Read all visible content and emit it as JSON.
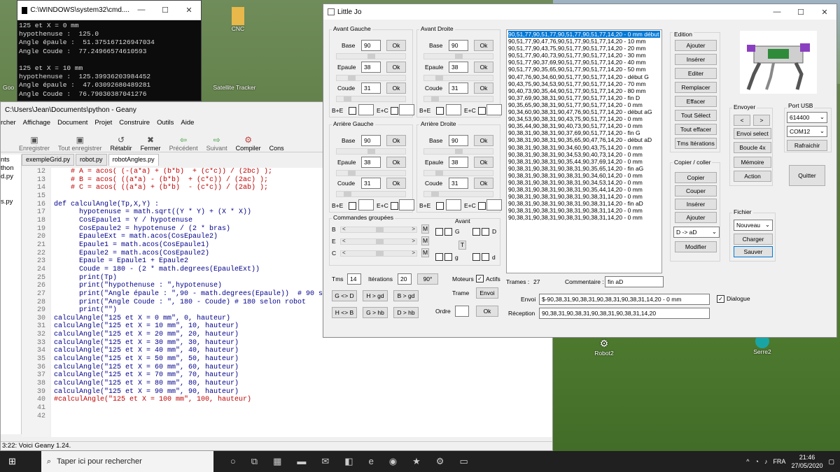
{
  "cmd": {
    "title": "C:\\WINDOWS\\system32\\cmd....",
    "lines": [
      "125 et X = 0 mm",
      "hypothenuse :  125.0",
      "Angle épaule :  51.375167126947034",
      "Angle Coude :  77.24966574610593",
      "",
      "125 et X = 10 mm",
      "hypothenuse :  125.39936203984452",
      "Angle épaule :  47.03092680489281",
      "Angle Coude :  76.79030387041276"
    ]
  },
  "desktop": {
    "cnc": "CNC",
    "satellite": "Satellite Tracker",
    "goo": "Goo",
    "robot2": "Robot2",
    "serre2": "Serre2"
  },
  "geany": {
    "title": "C:\\Users\\Jean\\Documents\\python - Geany",
    "menu": [
      "rcher",
      "Affichage",
      "Document",
      "Projet",
      "Construire",
      "Outils",
      "Aide"
    ],
    "tools": [
      "Enregistrer",
      "Tout enregistrer",
      "Rétablir",
      "Fermer",
      "Précédent",
      "Suivant",
      "Compiler",
      "Cons"
    ],
    "tabs": [
      "exempleGrid.py",
      "robot.py",
      "robotAngles.py"
    ],
    "side": [
      "nts",
      "thon",
      "d.py",
      "",
      "",
      "s.py"
    ],
    "gutter": "12\n13\n14\n15\n16\n17\n18\n19\n20\n21\n22\n23\n24\n25\n26\n27\n28\n29\n30\n31\n32\n33\n34\n35\n36\n37\n38\n39\n40\n41\n42",
    "code_red_top": "    # A = acos( (-(a*a) + (b*b)  + (c*c)) / (2bc) );\n    # B = acos( ((a*a) - (b*b)  + (c*c)) / (2ac) );\n    # C = acos( ((a*a) + (b*b)  - (c*c)) / (2ab) );",
    "code_def": "\n\ndef calculAngle(Tp,X,Y) :\n      hypotenuse = math.sqrt((Y * Y) + (X * X))\n      CosEpaule1 = Y / hypotenuse\n      CosEpaule2 = hypotenuse / (2 * bras)\n      EpauleExt = math.acos(CosEpaule2)\n      Epaule1 = math.acos(CosEpaule1)\n      Epaule2 = math.acos(CosEpaule2)\n      Epaule = Epaule1 + Epaule2\n      Coude = 180 - (2 * math.degrees(EpauleExt))\n      print(Tp)\n      print(\"hypothenuse : \",hypotenuse)\n      print(\"Angle épaule : \",90 - math.degrees(Epaule))  # 90 s\n      print(\"Angle Coude : \", 180 - Coude) # 180 selon robot\n      print(\"\")\n",
    "code_calls": "calculAngle(\"125 et X = 0 mm\", 0, hauteur)\ncalculAngle(\"125 et X = 10 mm\", 10, hauteur)\ncalculAngle(\"125 et X = 20 mm\", 20, hauteur)\ncalculAngle(\"125 et X = 30 mm\", 30, hauteur)\ncalculAngle(\"125 et X = 40 mm\", 40, hauteur)\ncalculAngle(\"125 et X = 50 mm\", 50, hauteur)\ncalculAngle(\"125 et X = 60 mm\", 60, hauteur)\ncalculAngle(\"125 et X = 70 mm\", 70, hauteur)\ncalculAngle(\"125 et X = 80 mm\", 80, hauteur)\ncalculAngle(\"125 et X = 90 mm\", 90, hauteur)",
    "code_last": "#calculAngle(\"125 et X = 100 mm\", 100, hauteur)",
    "status": "3:22: Voici Geany 1.24."
  },
  "lj": {
    "title": "Little Jo",
    "legs": [
      {
        "name": "Avant Gauche",
        "base": "90",
        "epaule": "38",
        "coude": "31"
      },
      {
        "name": "Avant Droite",
        "base": "90",
        "epaule": "38",
        "coude": "31"
      },
      {
        "name": "Arrière Gauche",
        "base": "90",
        "epaule": "38",
        "coude": "31"
      },
      {
        "name": "Arrière Droite",
        "base": "90",
        "epaule": "38",
        "coude": "31"
      }
    ],
    "lbl_base": "Base",
    "lbl_epaule": "Epaule",
    "lbl_coude": "Coude",
    "ok": "Ok",
    "be": "B+E",
    "ec": "E+C",
    "cmdgrp": "Commandes groupées",
    "b": "B",
    "e": "E",
    "c": "C",
    "m": "M",
    "avant": "Avant",
    "g": "G",
    "d": "D",
    "t": "T",
    "gs": "g",
    "ds": "d",
    "tms_lbl": "Tms",
    "tms": "14",
    "iter_lbl": "Itérations",
    "iter": "20",
    "deg90": "90°",
    "moteurs": "Moteurs",
    "actifs": "Actifs",
    "gd": "G <> D",
    "hgd": "H > gd",
    "bgd": "B > gd",
    "hb": "H <> B",
    "ghb": "G > hb",
    "dhb": "D > hb",
    "trame": "Trame",
    "envoi_btn": "Envoi",
    "ordre": "Ordre",
    "ok2": "Ok",
    "list": [
      "90,51,77,90,51,77,90,51,77,90,51,77,14,20 - 0 mm début",
      "90,51,77,90,47,76,90,51,77,90,51,77,14,20 - 10 mm",
      "90,51,77,90,43,75,90,51,77,90,51,77,14,20 - 20 mm",
      "90,51,77,90,40,73,90,51,77,90,51,77,14,20 - 30 mm",
      "90,51,77,90,37,69,90,51,77,90,51,77,14,20 - 40 mm",
      "90,51,77,90,35,65,90,51,77,90,51,77,14,20 - 50 mm",
      "90,47,76,90,34,60,90,51,77,90,51,77,14,20 - début G",
      "90,43,75,90,34,53,90,51,77,90,51,77,14,20 - 70 mm",
      "90,40,73,90,35,44,90,51,77,90,51,77,14,20 - 80 mm",
      "90,37,69,90,38,31,90,51,77,90,51,77,14,20 - fin D",
      "90,35,65,90,38,31,90,51,77,90,51,77,14,20 - 0 mm",
      "90,34,60,90,38,31,90,47,76,90,51,77,14,20 - début aG",
      "90,34,53,90,38,31,90,43,75,90,51,77,14,20 - 0 mm",
      "90,35,44,90,38,31,90,40,73,90,51,77,14,20 - 0 mm",
      "90,38,31,90,38,31,90,37,69,90,51,77,14,20 - fin G",
      "90,38,31,90,38,31,90,35,65,90,47,76,14,20 - début aD",
      "90,38,31,90,38,31,90,34,60,90,43,75,14,20 - 0 mm",
      "90,38,31,90,38,31,90,34,53,90,40,73,14,20 - 0 mm",
      "90,38,31,90,38,31,90,35,44,90,37,69,14,20 - 0 mm",
      "90,38,31,90,38,31,90,38,31,90,35,65,14,20 - fin aG",
      "90,38,31,90,38,31,90,38,31,90,34,60,14,20 - 0 mm",
      "90,38,31,90,38,31,90,38,31,90,34,53,14,20 - 0 mm",
      "90,38,31,90,38,31,90,38,31,90,35,44,14,20 - 0 mm",
      "90,38,31,90,38,31,90,38,31,90,38,31,14,20 - 0 mm",
      "90,38,31,90,38,31,90,38,31,90,38,31,14,20 - fin aD",
      "90,38,31,90,38,31,90,38,31,90,38,31,14,20 - 0 mm",
      "90,38,31,90,38,31,90,38,31,90,38,31,14,20 - 0 mm"
    ],
    "trames_lbl": "Trames :",
    "trames": "27",
    "comment_lbl": "Commentaire :",
    "comment": "fin aD",
    "envoi_lbl": "Envoi",
    "envoi": "$-90,38,31,90,38,31,90,38,31,90,38,31,14,20 - 0 mm",
    "dialogue": "Dialogue",
    "recep_lbl": "Réception",
    "recep": "90,38,31,90,38,31,90,38,31,90,38,31,14,20",
    "edition": "Edition",
    "ed_btns": [
      "Ajouter",
      "Insérer",
      "Editer",
      "Remplacer",
      "Effacer",
      "Tout Sélect",
      "Tout effacer",
      "Tms Itérations"
    ],
    "copier": "Copier / coller",
    "cp_btns": [
      "Copier",
      "Couper",
      "Insérer",
      "Ajouter"
    ],
    "cp_sel": "D -> aD",
    "modifier": "Modifier",
    "envoyer": "Envoyer",
    "lt": "<",
    "gt": ">",
    "envoi_select": "Envoi select",
    "boucle": "Boucle 4x",
    "memoire": "Mémoire",
    "action": "Action",
    "port": "Port USB",
    "baud": "614400",
    "com": "COM12",
    "rafraichir": "Rafraichir",
    "quitter": "Quitter",
    "fichier": "Fichier",
    "nouveau": "Nouveau",
    "charger": "Charger",
    "sauver": "Sauver"
  },
  "taskbar": {
    "search": "Taper ici pour rechercher",
    "lang": "FRA",
    "time": "21:46",
    "date": "27/05/2020"
  }
}
